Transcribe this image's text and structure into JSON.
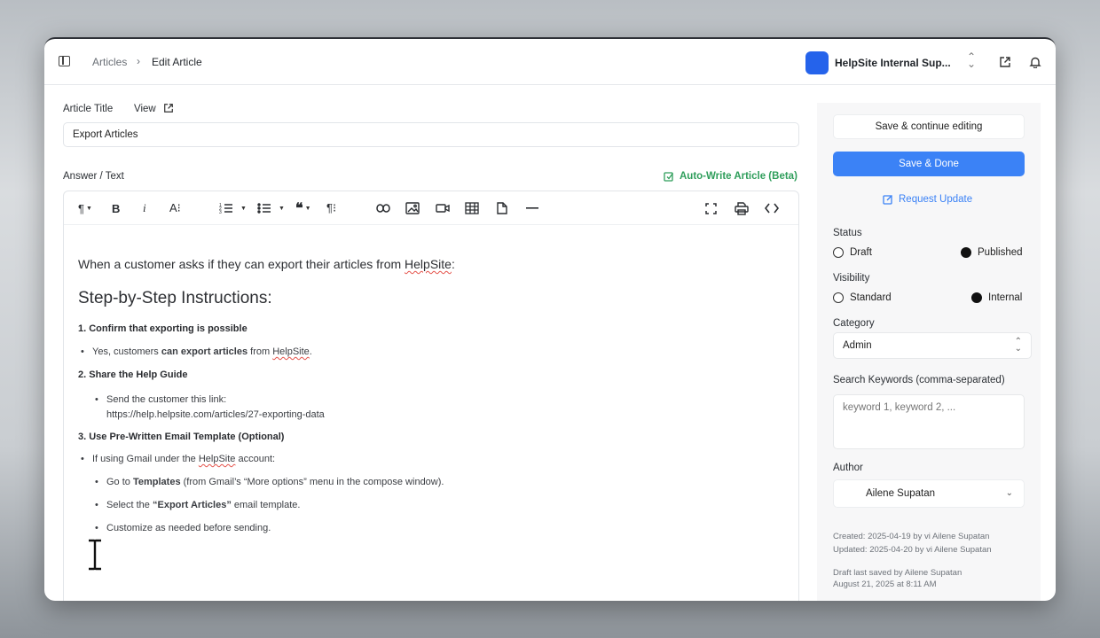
{
  "breadcrumb": {
    "parent": "Articles",
    "separator": "›",
    "current": "Edit Article"
  },
  "org": {
    "name": "HelpSite Internal Sup...",
    "logo_color": "#2563eb"
  },
  "article": {
    "title_label": "Article Title",
    "view_label": "View",
    "title_value": "Export Articles",
    "answer_label": "Answer / Text",
    "autowrite_label": "Auto-Write Article (Beta)"
  },
  "toolbar": {
    "icons": [
      "paragraph-icon",
      "bold-icon",
      "italic-icon",
      "text-size-icon",
      "ordered-list-icon",
      "unordered-list-icon",
      "quote-icon",
      "paragraph-format-icon",
      "link-icon",
      "image-icon",
      "video-icon",
      "table-icon",
      "file-icon",
      "horizontal-rule-icon",
      "fullscreen-icon",
      "print-icon",
      "code-view-icon"
    ]
  },
  "content": {
    "intro_pre": "When a customer asks if they can export their articles from ",
    "intro_brand": "HelpSite",
    "intro_post": ":",
    "heading": "Step-by-Step Instructions:",
    "step1": "1. Confirm that exporting is possible",
    "step1_b1_pre": "Yes, customers ",
    "step1_b1_bold": "can export articles",
    "step1_b1_mid": " from ",
    "step1_b1_brand": "HelpSite",
    "step1_b1_post": ".",
    "step2": "2. Share the Help Guide",
    "step2_b1_line1": "Send the customer this link:",
    "step2_b1_line2": "https://help.helpsite.com/articles/27-exporting-data",
    "step3": "3. Use Pre-Written Email Template (Optional)",
    "step3_b1_pre": "If using Gmail under the ",
    "step3_b1_brand": "HelpSite",
    "step3_b1_post": " account:",
    "step3_s1_pre": "Go to ",
    "step3_s1_bold": "Templates",
    "step3_s1_post": " (from Gmail’s “More options” menu in the compose window).",
    "step3_s2_pre": "Select the ",
    "step3_s2_bold": "“Export Articles”",
    "step3_s2_post": " email template.",
    "step3_s3": "Customize as needed before sending."
  },
  "sidebar": {
    "save_continue": "Save & continue editing",
    "save_done": "Save & Done",
    "request_update": "Request Update",
    "status_label": "Status",
    "status_options": [
      "Draft",
      "Published"
    ],
    "status_selected": "Published",
    "visibility_label": "Visibility",
    "visibility_options": [
      "Standard",
      "Internal"
    ],
    "visibility_selected": "Internal",
    "category_label": "Category",
    "category_value": "Admin",
    "keywords_label": "Search Keywords (comma-separated)",
    "keywords_placeholder": "keyword 1, keyword 2, ...",
    "author_label": "Author",
    "author_value": "Ailene Supatan",
    "created": "Created: 2025-04-19  by  vi  Ailene Supatan",
    "updated": "Updated: 2025-04-20  by  vi  Ailene Supatan",
    "draft_saved_line1": "Draft last saved by Ailene Supatan",
    "draft_saved_line2": "August 21, 2025 at 8:11 AM"
  },
  "colors": {
    "primary": "#3b82f6",
    "autowrite": "#2f9e5b",
    "spellcheck": "#e5534b"
  }
}
